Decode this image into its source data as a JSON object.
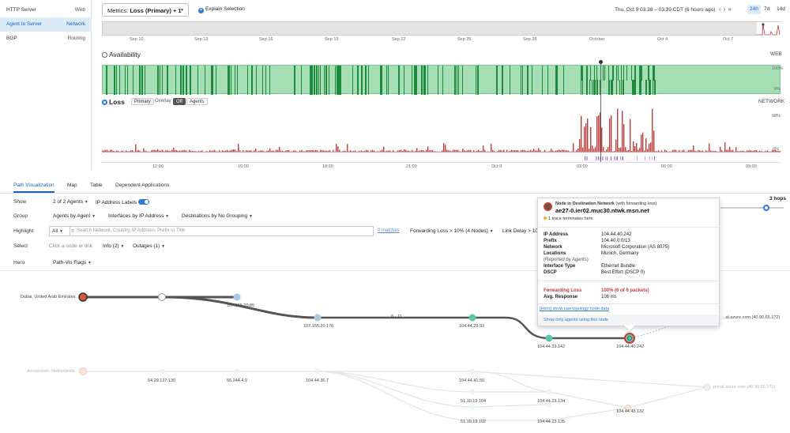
{
  "sidebar": {
    "items": [
      {
        "label": "HTTP Server",
        "type": "Web"
      },
      {
        "label": "Agent to Server",
        "type": "Network"
      },
      {
        "label": "BGP",
        "type": "Routing"
      }
    ]
  },
  "header": {
    "metrics_prefix": "Metrics: ",
    "metrics_main": "Loss",
    "metrics_suffix": " (Primary) + 1",
    "explain_label": "Explain Selection",
    "date_range": "Thu, Oct 9 03:38 – 03:39 CDT (6 hours ago)",
    "ranges": [
      "24h",
      "7d",
      "14d"
    ]
  },
  "timeline": {
    "ticks": [
      "Sep 10",
      "Sep 13",
      "Sep 16",
      "Sep 19",
      "Sep 22",
      "Sep 25",
      "Sep 28",
      "October",
      "Oct 4",
      "Oct 7"
    ]
  },
  "availability": {
    "title": "Availability",
    "right": "WEB",
    "ymax": "100%",
    "ymin": "0%"
  },
  "loss": {
    "title": "Loss",
    "primary": "Primary",
    "overlay": "Overlay",
    "off": "Off",
    "agents": "Agents",
    "right": "NETWORK",
    "ymax": "98%",
    "ymin": "0%",
    "ticks": [
      "12:00",
      "15:00",
      "18:00",
      "21:00",
      "Oct 9",
      "03:00",
      "06:00",
      "09:00"
    ]
  },
  "tabs": [
    "Path Visualization",
    "Map",
    "Table",
    "Dependent Applications"
  ],
  "controls": {
    "show_label": "Show",
    "show_value": "2 of 2 Agents",
    "ip_labels": "IP Address Labels",
    "group_label": "Group",
    "group_agents": "Agents by Agent",
    "group_interfaces": "Interfaces by IP Address",
    "group_destinations": "Destinations by No Grouping",
    "highlight_label": "Highlight",
    "highlight_all": "All",
    "search_placeholder": "Search Network, Country, IP Address, Prefix or Title",
    "matches": "0 matches",
    "forwarding_loss": "Forwarding Loss > 10% (4 Nodes)",
    "link_delay": "Link Delay > 100",
    "select_label": "Select",
    "select_hint": "Click a node or link",
    "info": "Info (2)",
    "outages": "Outages (1)",
    "hero_label": "Hero",
    "hero_value": "Path-Vis Flags",
    "hops": "3 hops"
  },
  "graph": {
    "labels": {
      "dubai": "Dubai, United Arab Emirates",
      "ip1": "107.155.20.85",
      "ip2": "107.155.20.176",
      "hops_range": "8 - 11",
      "ip3": "104.44.29.92",
      "ip4": "104.44.33.142",
      "ip5": "104.44.40.242",
      "azure1": "…al.azure.com (40.90.65.172)",
      "amsterdam": "Amsterdam, Netherlands",
      "ip6": "64.29.137.130",
      "ip7": "66.244.4.9",
      "ip8": "104.44.36.7",
      "ip9": "104.44.41.50",
      "ip10": "51.10.19.104",
      "ip11": "104.44.23.134",
      "ip12": "104.44.43.132",
      "ip13": "51.10.19.102",
      "ip14": "104.44.23.135",
      "azure2": "portal.azure.com (40.90.65.172)"
    }
  },
  "popup": {
    "title_prefix": "Node in Destination Network",
    "title_suffix": " (with forwarding loss)",
    "hostname": "ae27-0.ier02.muc30.ntwk.msn.net",
    "trace_note": "1 trace terminates here",
    "ip_address_k": "IP Address",
    "ip_address_v": "104.44.40.242",
    "prefix_k": "Prefix",
    "prefix_v": "104.40.0.0/13",
    "network_k": "Network",
    "network_v": "Microsoft Corporation (AS 8075)",
    "locations_k": "Locations",
    "locations_v": "Munich, Germany",
    "reported": "(Reported by Agents)",
    "interface_k": "Interface Type",
    "interface_v": "Ethernet Bundle",
    "dscp_k": "DSCP",
    "dscp_v": "Best Effort (DSCP 0)",
    "fwd_loss_k": "Forwarding Loss",
    "fwd_loss_v": "100% (6 of 6 packets)",
    "avg_resp_k": "Avg. Response",
    "avg_resp_v": "108 ms",
    "hero_link": "[Hero] show raw topology node data",
    "agents_link": "Show only agents using this node"
  },
  "colors": {
    "accent": "#2d7bd8",
    "availability_fill": "#a6dfb5",
    "availability_dark": "#1f8a3c",
    "loss_red": "#c43b3b",
    "node_teal": "#5ec4aa",
    "node_blue": "#a9c9e4",
    "node_red": "#d94b3a"
  }
}
